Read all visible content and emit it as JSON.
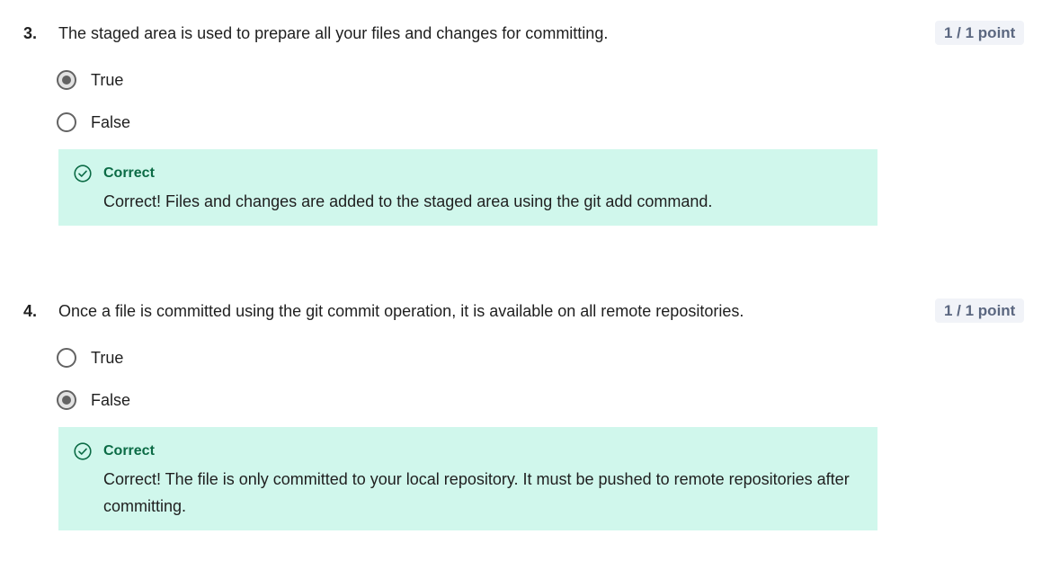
{
  "questions": [
    {
      "number": "3.",
      "text": "The staged area is used to prepare all your files and changes for committing.",
      "points": "1 / 1 point",
      "options": [
        {
          "label": "True",
          "selected": true
        },
        {
          "label": "False",
          "selected": false
        }
      ],
      "feedback": {
        "status": "Correct",
        "message": "Correct! Files and changes are added to the staged area using the git add command."
      }
    },
    {
      "number": "4.",
      "text": "Once a file is committed using the git commit operation, it is available on all remote repositories.",
      "points": "1 / 1 point",
      "options": [
        {
          "label": "True",
          "selected": false
        },
        {
          "label": "False",
          "selected": true
        }
      ],
      "feedback": {
        "status": "Correct",
        "message": "Correct! The file is only committed to your local repository. It must be pushed to remote repositories after committing."
      }
    }
  ],
  "colors": {
    "feedback_background": "#d0f7ec",
    "correct_accent": "#0b6b45",
    "points_badge_background": "#f1f3f8",
    "points_badge_text": "#5b6780",
    "radio_border": "#636363"
  },
  "icons": {
    "feedback_status": "check-circle-icon"
  }
}
